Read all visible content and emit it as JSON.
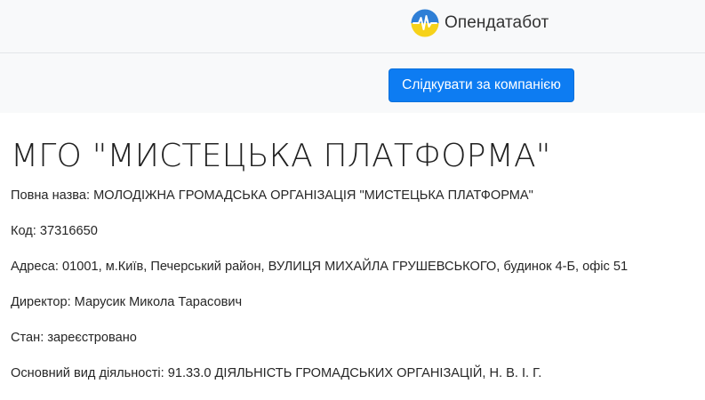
{
  "header": {
    "brand_name": "Опендатабот",
    "logo_icon": "opendatabot-logo-icon",
    "colors": {
      "logo_top": "#2f7fd6",
      "logo_bottom": "#f6d21a",
      "accent": "#0d7cf2"
    }
  },
  "actions": {
    "follow_label": "Слідкувати за компанією"
  },
  "company": {
    "title": "МГО \"МИСТЕЦЬКА ПЛАТФОРМА\"",
    "full_name": "Повна назва: МОЛОДІЖНА ГРОМАДСЬКА ОРГАНІЗАЦІЯ \"МИСТЕЦЬКА ПЛАТФОРМА\"",
    "code": "Код: 37316650",
    "address": "Адреса: 01001, м.Київ, Печерський район, ВУЛИЦЯ МИХАЙЛА ГРУШЕВСЬКОГО, будинок 4-Б, офіс 51",
    "director": "Директор: Марусик Микола Тарасович",
    "status": "Стан: зареєстровано",
    "activity": "Основний вид діяльності: 91.33.0 ДІЯЛЬНІСТЬ ГРОМАДСЬКИХ ОРГАНІЗАЦІЙ, Н. В. І. Г."
  }
}
